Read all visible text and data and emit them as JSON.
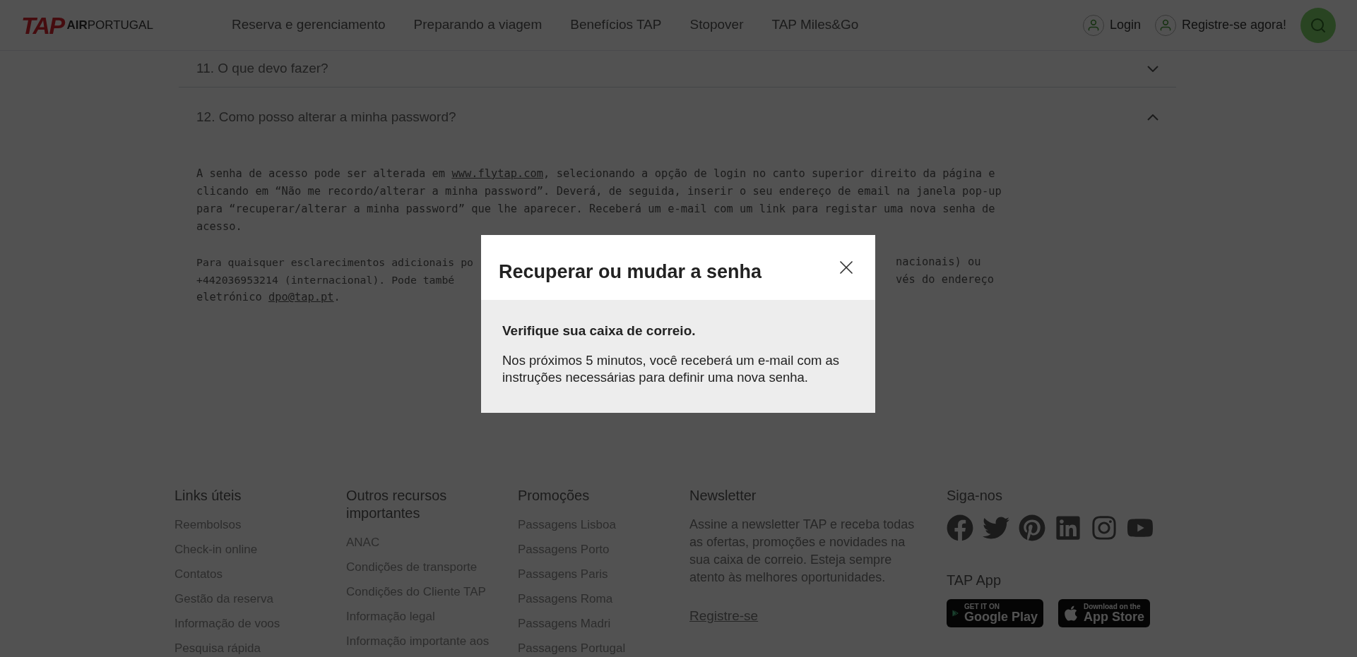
{
  "header": {
    "logo": {
      "mark": "TAP",
      "wordmark": "**AIR**PORTUGAL"
    },
    "nav": [
      "Reserva e gerenciamento",
      "Preparando a viagem",
      "Benefícios TAP",
      "Stopover",
      "TAP Miles&Go"
    ],
    "login": "Login",
    "register": "Registre-se agora!"
  },
  "faq": {
    "items": [
      {
        "question": "11. O que devo fazer?",
        "expanded": false
      },
      {
        "question": "12. Como posso alterar a minha password?",
        "expanded": true
      }
    ],
    "answer": {
      "before": "A senha de acesso pode ser alterada em ",
      "link": "www.flytap.com",
      "after": ", selecionando a opção de login no canto superior direito da página e clicando em “Não me recordo/alterar a minha password”. Deverá, de seguida, inserir o seu endereço de email na janela pop-up para “recuperar/alterar a minha password” que lhe aparecer. Receberá um e-mail com um link para registar uma nova senha de acesso."
    },
    "contact_lines": [
      {
        "left": "Para quaisquer esclarecimentos adicionais po",
        "right": "nacionais) ou"
      },
      {
        "left": "+442036953214 (internacional). Pode també",
        "right": "vés do endereço"
      }
    ],
    "contact_last": {
      "before": "eletrónico ",
      "link": "dpo@tap.pt",
      "after": "."
    }
  },
  "modal": {
    "title": "Recuperar ou mudar a senha",
    "heading": "Verifique sua caixa de correio.",
    "message": "Nos próximos 5 minutos, você receberá um e-mail com as instruções necessárias para definir uma nova senha."
  },
  "footer": {
    "columns": [
      {
        "title": "Links úteis",
        "links": [
          "Reembolsos",
          "Check-in online",
          "Contatos",
          "Gestão da reserva",
          "Informação de voos",
          "Pesquisa rápida"
        ]
      },
      {
        "title": "Outros recursos importantes",
        "links": [
          "ANAC",
          "Condições de transporte",
          "Condições do Cliente TAP",
          "Informação legal",
          "Informação importante aos"
        ]
      },
      {
        "title": "Promoções",
        "links": [
          "Passagens Lisboa",
          "Passagens Porto",
          "Passagens Paris",
          "Passagens Roma",
          "Passagens Madri",
          "Passagens Portugal"
        ]
      }
    ],
    "newsletter": {
      "title": "Newsletter",
      "text": "Assine a newsletter TAP e receba todas as ofertas, promoções e novidades na sua caixa de correio. Esteja sempre atento às melhores oportunidades.",
      "link": "Registre-se"
    },
    "social": {
      "title": "Siga-nos",
      "icons": [
        {
          "kind": "facebook"
        },
        {
          "kind": "twitter"
        },
        {
          "kind": "pinterest"
        },
        {
          "kind": "linkedin"
        },
        {
          "kind": "instagram"
        },
        {
          "kind": "youtube"
        }
      ]
    },
    "app": {
      "title": "TAP App",
      "badges": [
        {
          "kind": "google",
          "small": "GET IT ON",
          "big": "Google Play"
        },
        {
          "kind": "apple",
          "small": "Download on the",
          "big": "App Store"
        }
      ]
    }
  }
}
